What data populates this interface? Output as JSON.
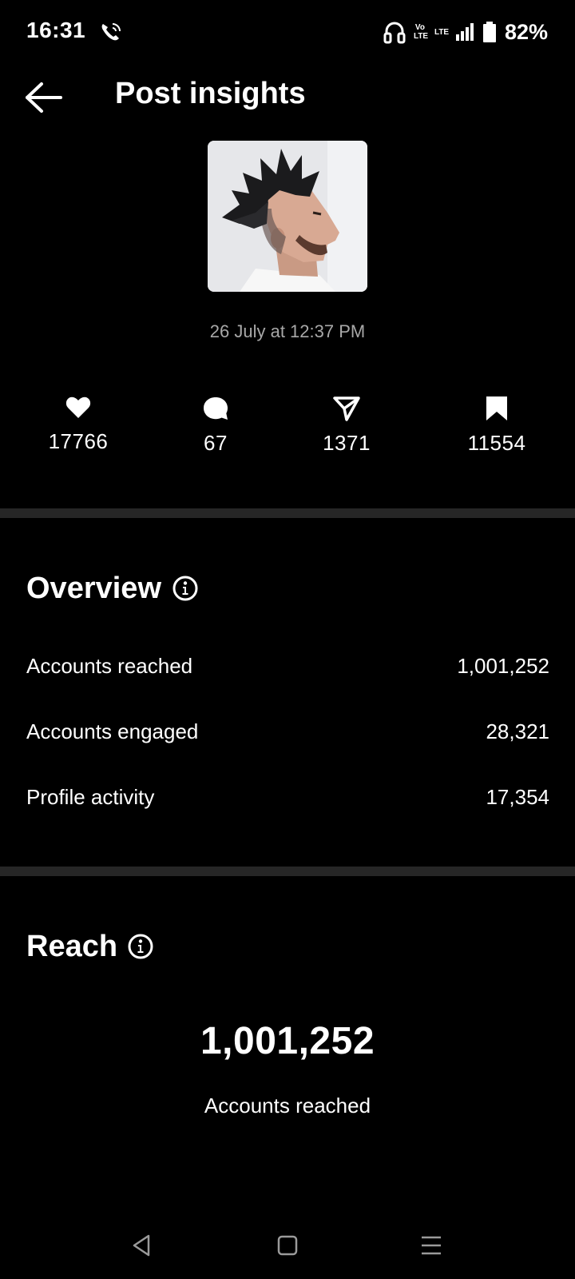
{
  "status_bar": {
    "time": "16:31",
    "net_top": "Vo",
    "net_bottom": "LTE",
    "lte_label": "LTE",
    "battery": "82%",
    "icons": [
      "wifi-call-icon",
      "headset-icon",
      "signal-icon",
      "battery-icon"
    ]
  },
  "header": {
    "title": "Post insights",
    "back_icon": "arrow-left-icon"
  },
  "post": {
    "date": "26 July at 12:37 PM"
  },
  "stats": {
    "likes": "17766",
    "comments": "67",
    "shares": "1371",
    "saves": "11554"
  },
  "overview": {
    "title": "Overview",
    "rows": [
      {
        "label": "Accounts reached",
        "value": "1,001,252"
      },
      {
        "label": "Accounts engaged",
        "value": "28,321"
      },
      {
        "label": "Profile activity",
        "value": "17,354"
      }
    ]
  },
  "reach": {
    "title": "Reach",
    "number": "1,001,252",
    "label": "Accounts reached"
  },
  "colors": {
    "background": "#000000",
    "divider": "#262626",
    "muted_text": "#a8a8a8"
  }
}
